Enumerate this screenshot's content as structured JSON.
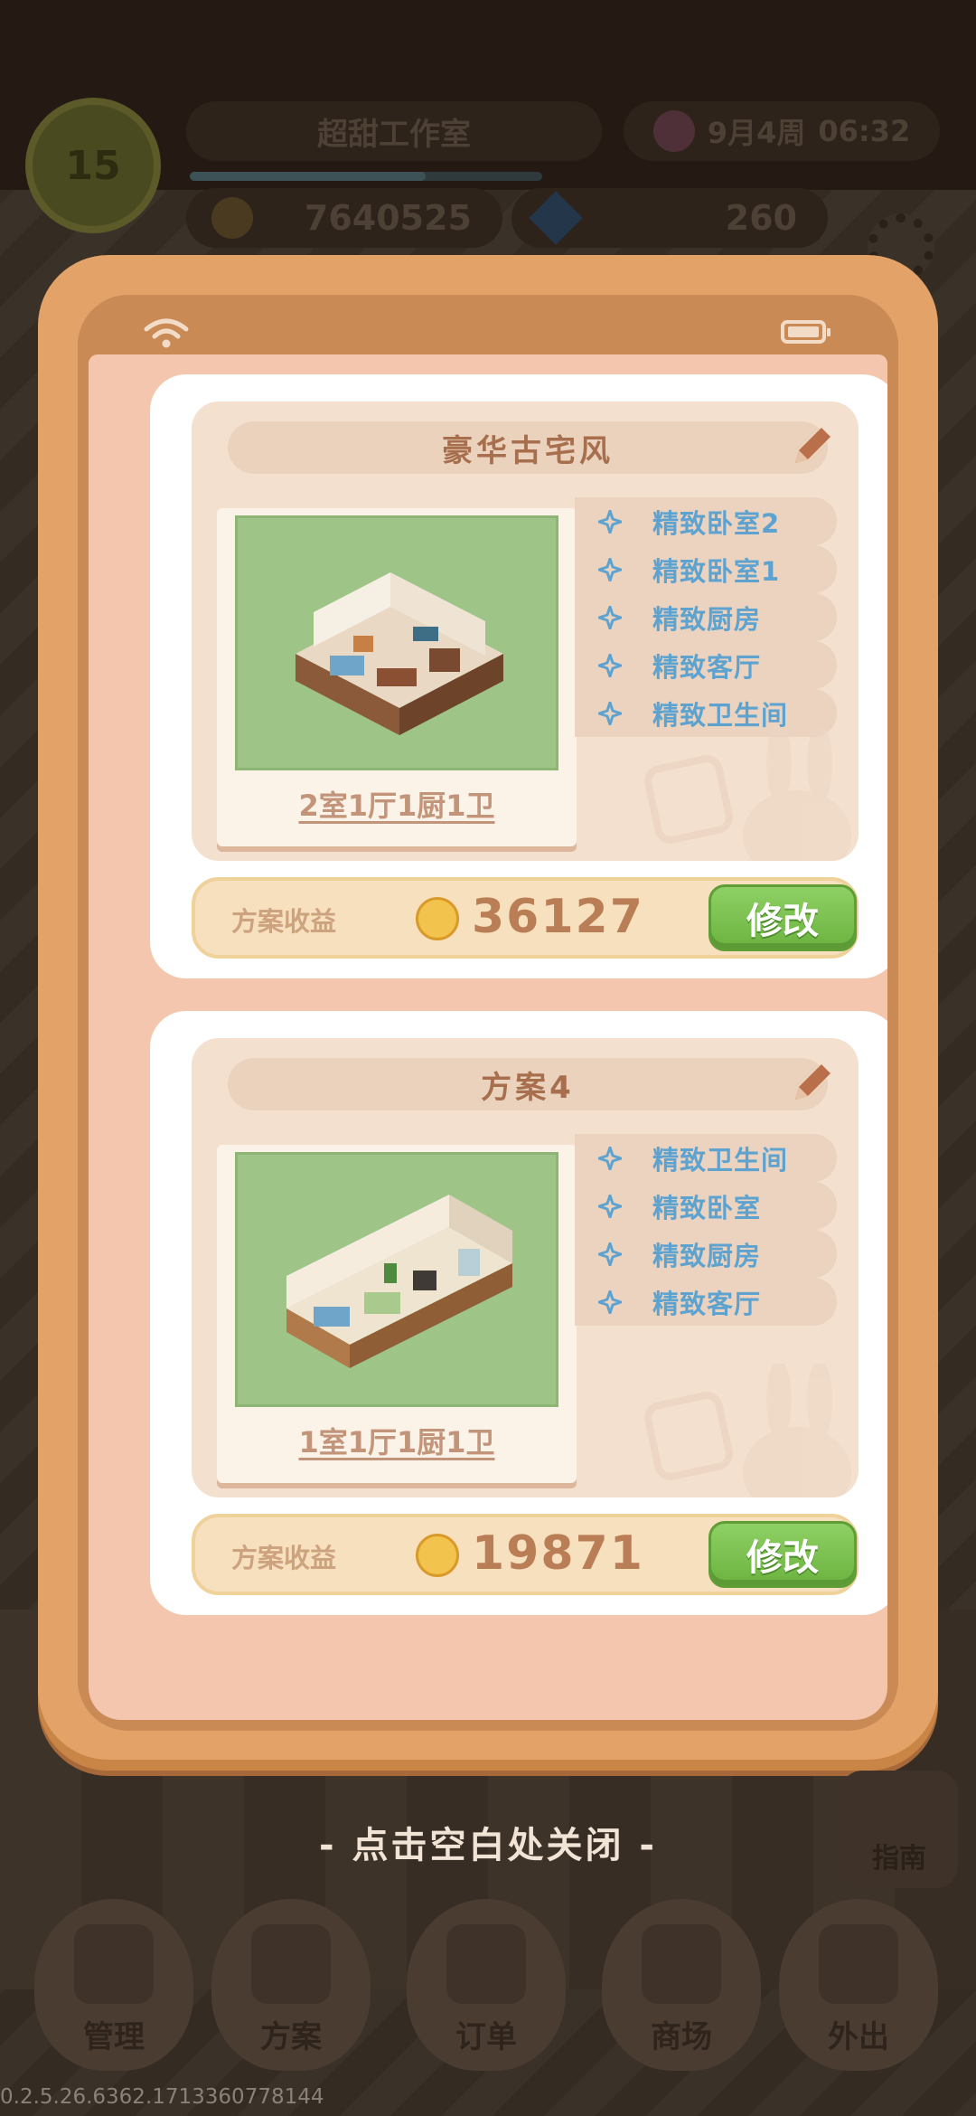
{
  "hud": {
    "level": "15",
    "studio_name": "超甜工作室",
    "date": "9月4周",
    "time": "06:32",
    "level_progress": 0.67,
    "coins": "7640525",
    "gems": "260"
  },
  "plans": [
    {
      "title": "豪华古宅风",
      "layout": "2室1厅1厨1卫",
      "rooms": [
        "精致卧室2",
        "精致卧室1",
        "精致厨房",
        "精致客厅",
        "精致卫生间"
      ],
      "income_label": "方案收益",
      "income": "36127",
      "modify_label": "修改"
    },
    {
      "title": "方案4",
      "layout": "1室1厅1厨1卫",
      "rooms": [
        "精致卫生间",
        "精致卧室",
        "精致厨房",
        "精致客厅"
      ],
      "income_label": "方案收益",
      "income": "19871",
      "modify_label": "修改"
    }
  ],
  "close_hint": "- 点击空白处关闭 -",
  "guide_label": "指南",
  "nav": [
    {
      "label": "管理",
      "icon": "hammer-icon"
    },
    {
      "label": "方案",
      "icon": "blueprint-icon"
    },
    {
      "label": "订单",
      "icon": "clipboard-icon"
    },
    {
      "label": "商场",
      "icon": "basket-icon"
    },
    {
      "label": "外出",
      "icon": "map-icon"
    }
  ],
  "version": "0.2.5.26.6362.1713360778144",
  "colors": {
    "modal_frame": "#e3a267",
    "modal_screen": "#f4c6ad",
    "room_text": "#5ea3cf",
    "income_text": "#b97e56",
    "modify_button": "#6bb340"
  }
}
